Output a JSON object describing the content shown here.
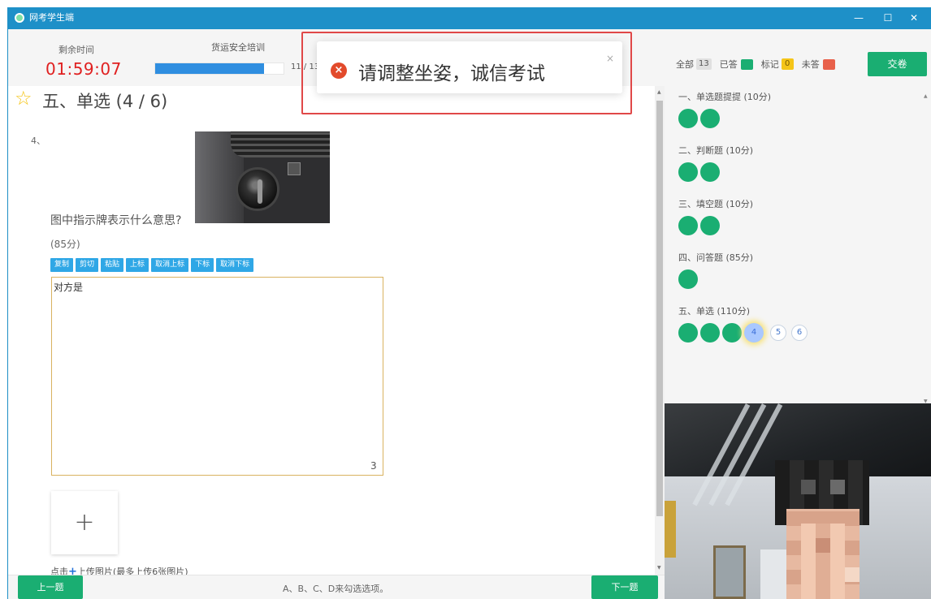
{
  "window": {
    "title": "网考学生端",
    "min_icon": "minimize-icon",
    "max_icon": "maximize-icon",
    "close_icon": "close-icon"
  },
  "header": {
    "timer_label": "剩余时间",
    "timer_value": "01:59:07",
    "exam_name": "货运安全培训",
    "progress_text": "11 / 13",
    "progress_fraction": 0.846
  },
  "question": {
    "section_title": "五、单选 (4 / 6)",
    "number": "4、",
    "text": "图中指示牌表示什么意思?",
    "score": "(85分)",
    "answer_value": "对方是",
    "char_count": "3",
    "upload_plus": "+",
    "upload_hint_plus": "+",
    "upload_hint_prefix": "点击",
    "upload_hint_suffix": "上传图片(最多上传6张图片)"
  },
  "toolbar": {
    "copy": "复制",
    "cut": "剪切",
    "paste": "粘贴",
    "superscript": "上标",
    "cancel_superscript": "取消上标",
    "subscript": "下标",
    "cancel_subscript": "取消下标"
  },
  "footer": {
    "prev_label": "上一题",
    "hint": "A、B、C、D来勾选选项。",
    "next_label": "下一题"
  },
  "panel": {
    "all_label": "全部",
    "all_count": "13",
    "answered_label": "已答",
    "marked_label": "标记",
    "marked_count": "0",
    "unanswered_label": "未答",
    "submit_label": "交卷",
    "colors": {
      "answered": "#1aae72",
      "marked": "#f5c518",
      "unanswered": "#e8604a",
      "accent": "#1e90c8"
    },
    "groups": [
      {
        "title": "一、单选题提提 (10分)",
        "answered": 2
      },
      {
        "title": "二、判断题 (10分)",
        "answered": 2
      },
      {
        "title": "三、填空题 (10分)",
        "answered": 2
      },
      {
        "title": "四、问答题 (85分)",
        "answered": 1
      },
      {
        "title": "五、单选 (110分)",
        "answered": 3,
        "current": "4",
        "pending": [
          "5",
          "6"
        ]
      }
    ]
  },
  "toast": {
    "message": "请调整坐姿，诚信考试",
    "close": "×",
    "icon": "error-circle-icon"
  }
}
